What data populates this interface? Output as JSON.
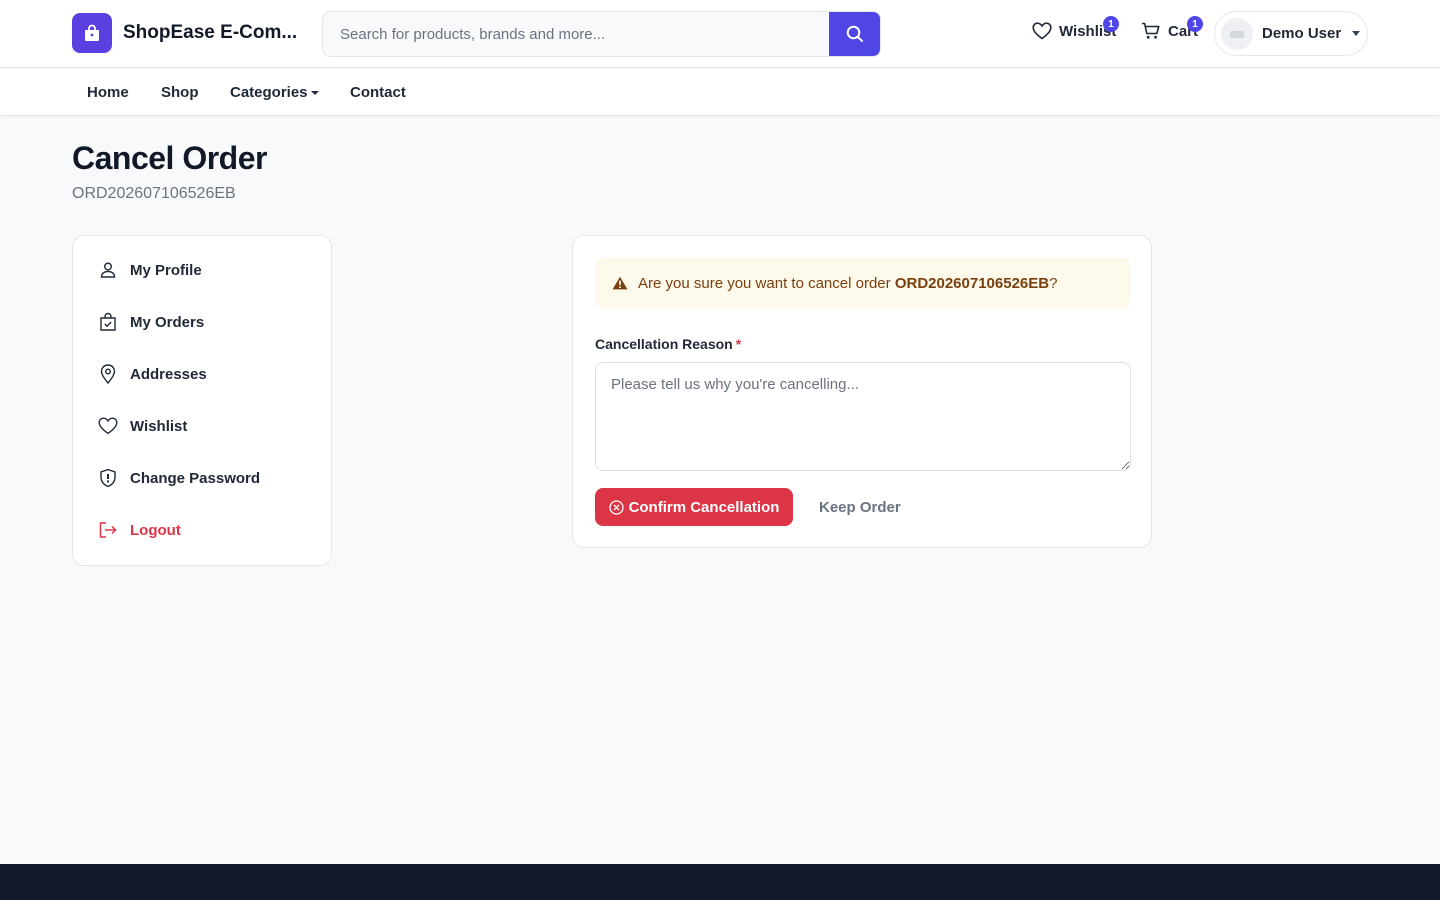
{
  "header": {
    "brand_name": "ShopEase E-Com...",
    "search_placeholder": "Search for products, brands and more...",
    "wishlist_label": "Wishlist",
    "wishlist_count": "1",
    "cart_label": "Cart",
    "cart_count": "1",
    "user_name": "Demo User"
  },
  "nav": {
    "items": [
      "Home",
      "Shop",
      "Categories",
      "Contact"
    ]
  },
  "page": {
    "title": "Cancel Order",
    "order_id": "ORD202607106526EB"
  },
  "sidebar": {
    "items": [
      {
        "label": "My Profile",
        "icon": "user-icon"
      },
      {
        "label": "My Orders",
        "icon": "bag-check-icon"
      },
      {
        "label": "Addresses",
        "icon": "map-pin-icon"
      },
      {
        "label": "Wishlist",
        "icon": "heart-icon"
      },
      {
        "label": "Change Password",
        "icon": "shield-icon"
      },
      {
        "label": "Logout",
        "icon": "logout-icon"
      }
    ]
  },
  "cancel_form": {
    "alert_prefix": "Are you sure you want to cancel order ",
    "alert_order": "ORD202607106526EB",
    "alert_suffix": "?",
    "reason_label": "Cancellation Reason",
    "reason_required_mark": "*",
    "reason_value": "",
    "reason_placeholder": "Please tell us why you're cancelling...",
    "confirm_label": "Confirm Cancellation",
    "keep_label": "Keep Order"
  },
  "colors": {
    "brand": "#5b3fe0",
    "primary": "#4f46e5",
    "danger": "#dc3545",
    "warning_bg": "#fdfaeb",
    "warning_text": "#7a3f0e",
    "footer": "#111827"
  }
}
